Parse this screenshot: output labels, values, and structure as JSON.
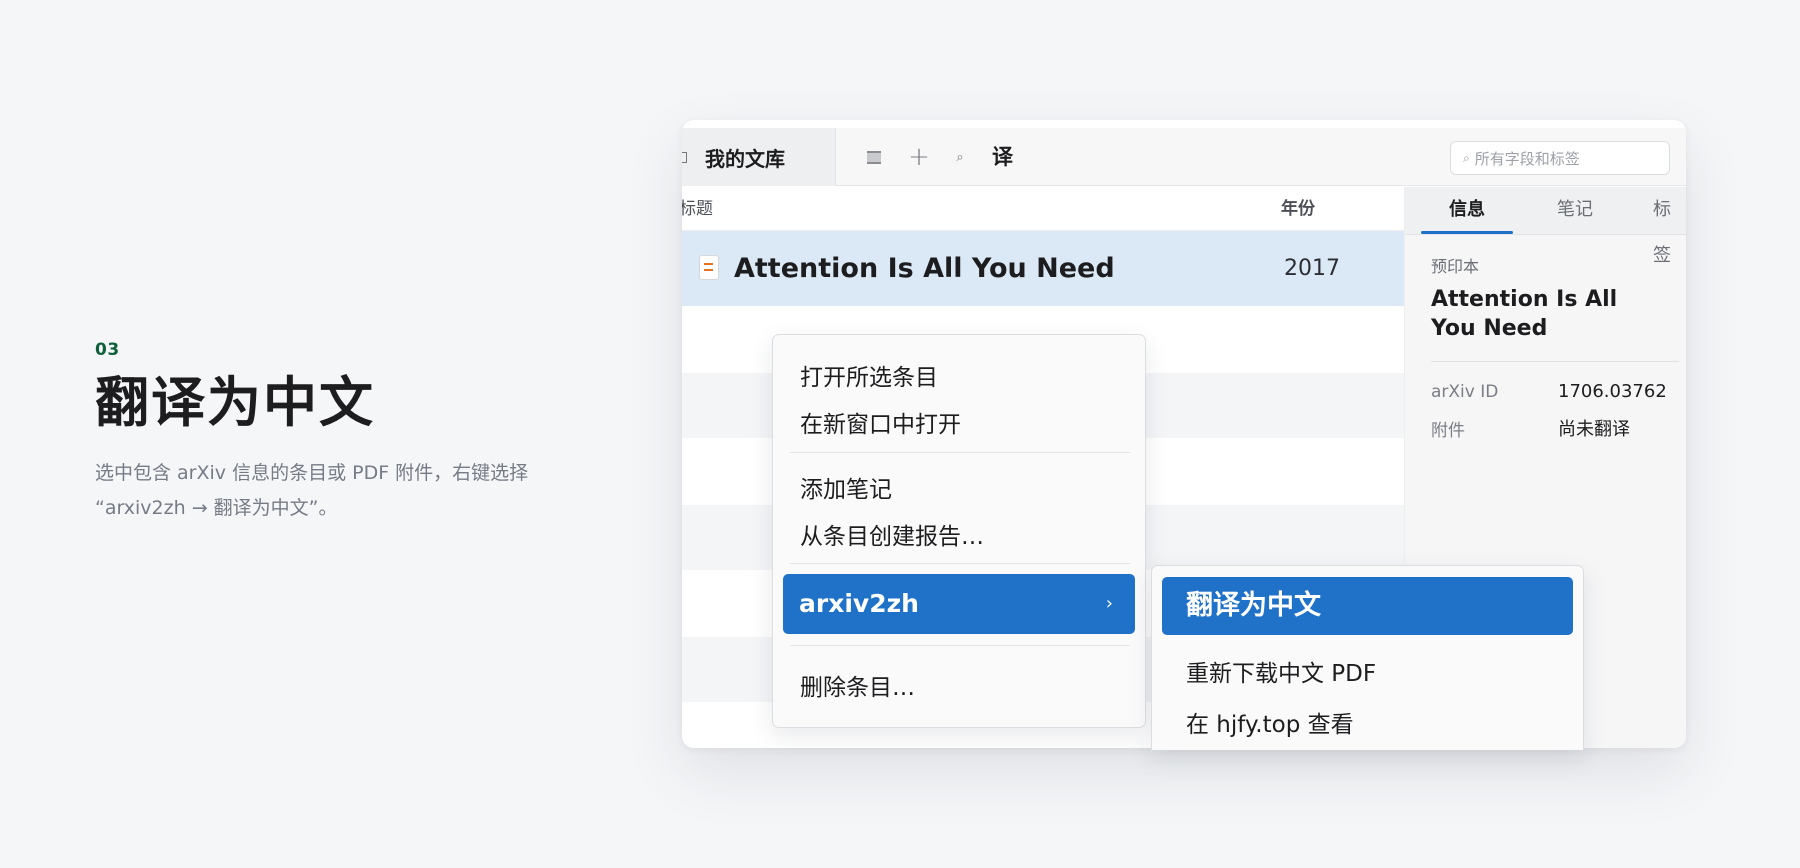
{
  "caption": {
    "step": "03",
    "title": "翻译为中文",
    "desc_line1": "选中包含 arXiv 信息的条目或 PDF 附件，右键选择",
    "desc_line2": "“arxiv2zh → 翻译为中文”。"
  },
  "toolbar": {
    "library_tab": "我的文库",
    "translate_label": "译",
    "search_placeholder": "所有字段和标签",
    "icons": [
      "list-icon",
      "plus-icon",
      "search-icon"
    ]
  },
  "list": {
    "columns": {
      "title": "标题",
      "year": "年份"
    },
    "selected_row": {
      "title": "Attention Is All You Need",
      "year": "2017"
    }
  },
  "pane": {
    "tabs": [
      "信息",
      "笔记",
      "标签"
    ],
    "active_tab": "信息",
    "item_type": "预印本",
    "title": "Attention Is All You Need",
    "fields": [
      {
        "label": "arXiv ID",
        "value": "1706.03762"
      },
      {
        "label": "附件",
        "value": "尚未翻译"
      }
    ]
  },
  "context_menu": {
    "items": [
      "打开所选条目",
      "在新窗口中打开",
      "添加笔记",
      "从条目创建报告…",
      "arxiv2zh",
      "删除条目…"
    ],
    "highlighted": "arxiv2zh",
    "chevron": "›"
  },
  "submenu": {
    "items": [
      "翻译为中文",
      "重新下载中文 PDF",
      "在 hjfy.top 查看"
    ],
    "highlighted": "翻译为中文"
  },
  "colors": {
    "accent": "#1f72c8",
    "step_green": "#0f5f3a",
    "selection": "#dbe9f6",
    "background": "#f5f6f8"
  }
}
